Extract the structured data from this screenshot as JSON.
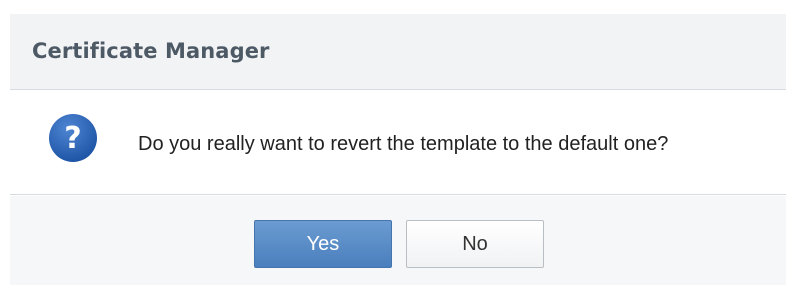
{
  "dialog": {
    "title": "Certificate Manager",
    "message": "Do you really want to revert the template to the default one?",
    "icon": "question-icon",
    "buttons": {
      "yes_label": "Yes",
      "no_label": "No"
    },
    "colors": {
      "icon": "#2b62b3",
      "primary_button": "#5a8cc8",
      "title_text": "#4d5a66"
    }
  }
}
